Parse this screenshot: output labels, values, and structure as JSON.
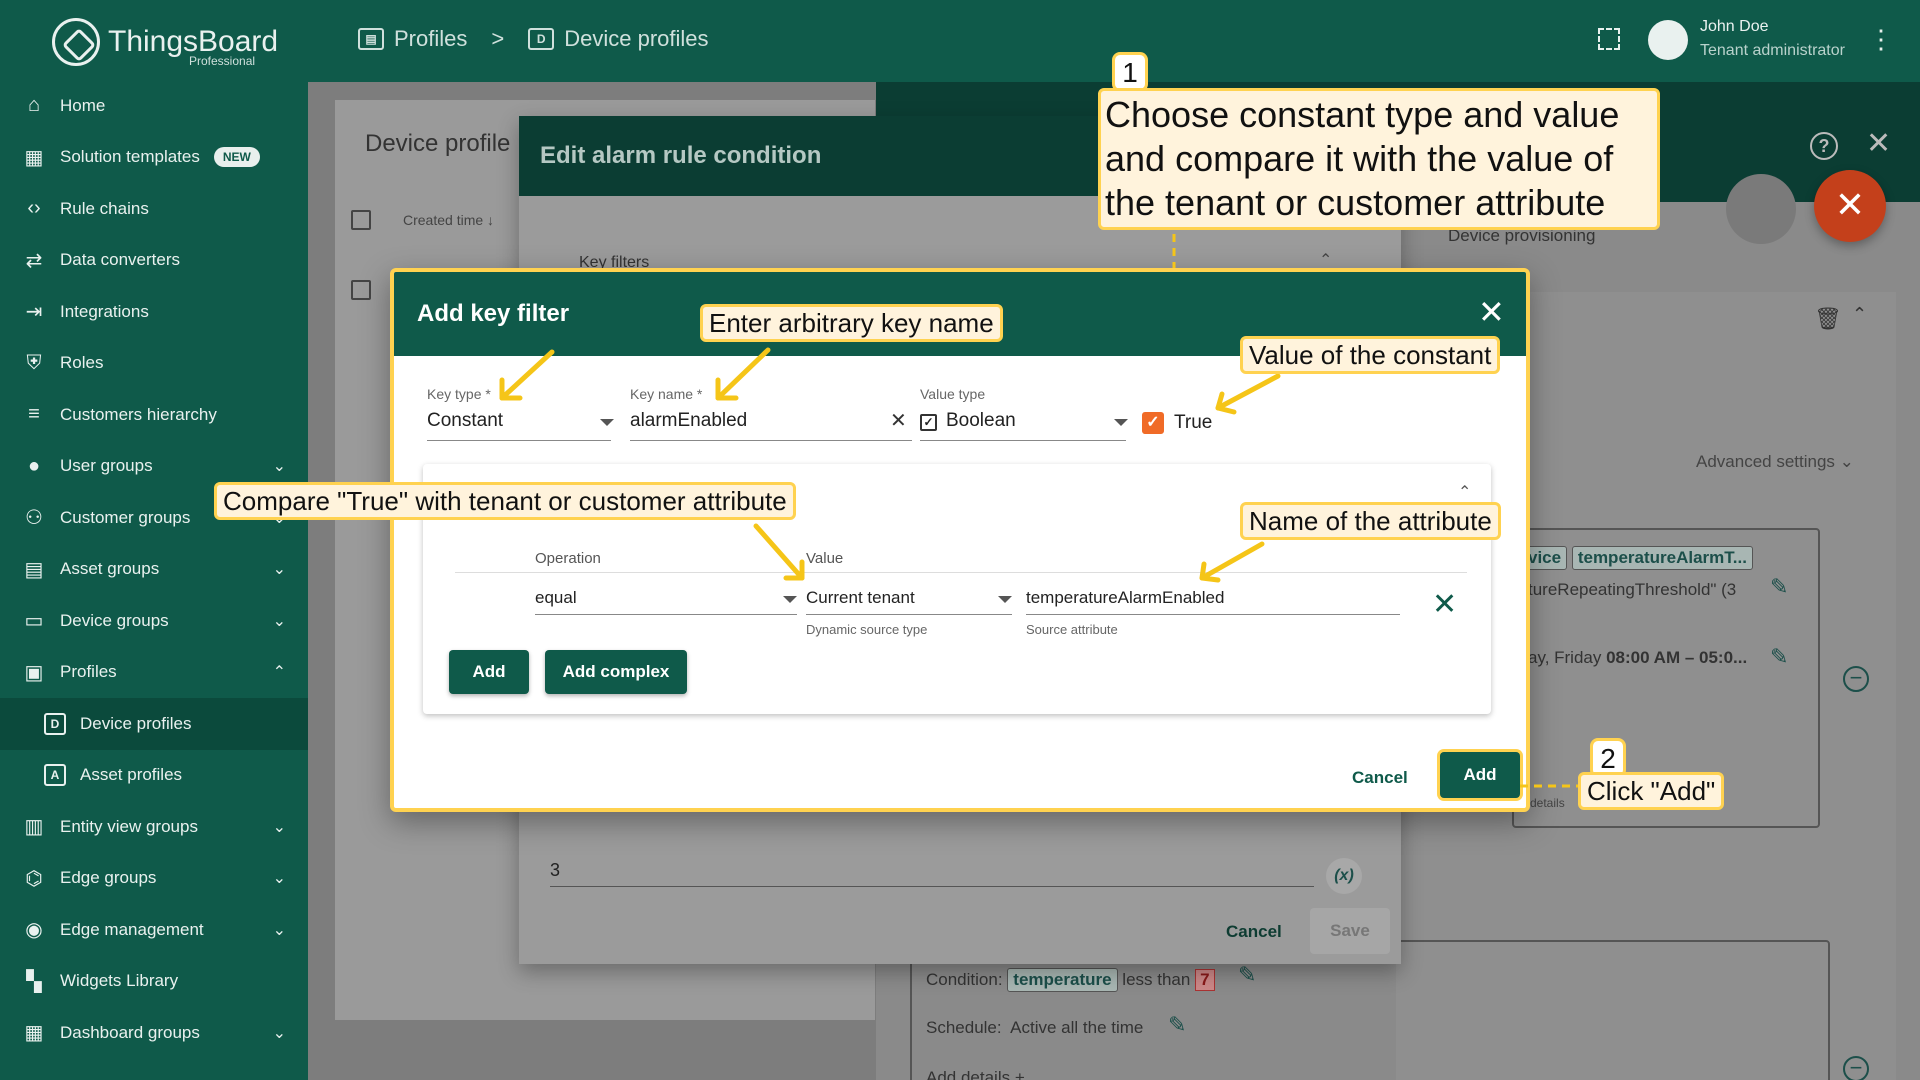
{
  "app": {
    "logo_name": "ThingsBoard",
    "logo_sub": "Professional"
  },
  "sidebar": {
    "items": [
      {
        "label": "Home",
        "icon": "home-icon"
      },
      {
        "label": "Solution templates",
        "icon": "grid-icon",
        "badge": "NEW"
      },
      {
        "label": "Rule chains",
        "icon": "code-icon"
      },
      {
        "label": "Data converters",
        "icon": "transform-icon"
      },
      {
        "label": "Integrations",
        "icon": "input-icon"
      },
      {
        "label": "Roles",
        "icon": "shield-icon"
      },
      {
        "label": "Customers hierarchy",
        "icon": "sort-icon"
      },
      {
        "label": "User groups",
        "icon": "account-icon",
        "expandable": true
      },
      {
        "label": "Customer groups",
        "icon": "group-icon",
        "expandable": true
      },
      {
        "label": "Asset groups",
        "icon": "building-icon",
        "expandable": true
      },
      {
        "label": "Device groups",
        "icon": "devices-icon",
        "expandable": true
      },
      {
        "label": "Profiles",
        "icon": "badge-icon",
        "expandable": true,
        "expanded": true
      },
      {
        "label": "Device profiles",
        "icon": "device-profile-icon",
        "sub": true,
        "active": true,
        "glyph": "D"
      },
      {
        "label": "Asset profiles",
        "icon": "asset-profile-icon",
        "sub": true,
        "glyph": "A"
      },
      {
        "label": "Entity view groups",
        "icon": "view-icon",
        "expandable": true
      },
      {
        "label": "Edge groups",
        "icon": "router-icon",
        "expandable": true
      },
      {
        "label": "Edge management",
        "icon": "wifi-icon",
        "expandable": true
      },
      {
        "label": "Widgets Library",
        "icon": "widgets-icon"
      },
      {
        "label": "Dashboard groups",
        "icon": "dashboard-icon",
        "expandable": true
      }
    ]
  },
  "topbar": {
    "breadcrumb": [
      {
        "label": "Profiles"
      },
      {
        "label": "Device profiles",
        "glyph": "D"
      }
    ],
    "breadcrumb_sep": ">",
    "user_name": "John Doe",
    "user_role": "Tenant administrator"
  },
  "background": {
    "profiles_title": "Device profile",
    "created_time_col": "Created time",
    "provisioning_tab": "Device provisioning",
    "advanced_settings": "Advanced settings",
    "alarm_chip_1": "vice",
    "alarm_chip_2": "temperatureAlarmT...",
    "alarm_line2": "tureRepeatingThreshold\" (3",
    "alarm_line3_prefix": "ay, Friday ",
    "alarm_line3_bold": "08:00 AM – 05:0...",
    "details_small": "details",
    "condition_label": "Condition:",
    "condition_key": "temperature",
    "condition_op": "less than",
    "condition_value": "7",
    "schedule_label": "Schedule:",
    "schedule_value": "Active all the time",
    "add_details": "Add details"
  },
  "edit_dialog": {
    "title": "Edit alarm rule condition",
    "key_filters_label": "Key filters",
    "bottom_value": "3",
    "fx_label": "(x)",
    "cancel": "Cancel",
    "save": "Save"
  },
  "add_key_filter": {
    "title": "Add key filter",
    "key_type_label": "Key type *",
    "key_type_value": "Constant",
    "key_name_label": "Key name *",
    "key_name_value": "alarmEnabled",
    "value_type_label": "Value type",
    "value_type_value": "Boolean",
    "constant_value_label": "True",
    "constant_checked": true,
    "operation_header": "Operation",
    "value_header": "Value",
    "operation_value": "equal",
    "dynamic_source_value": "Current tenant",
    "dynamic_source_hint": "Dynamic source type",
    "source_attribute_value": "temperatureAlarmEnabled",
    "source_attribute_hint": "Source attribute",
    "add_button": "Add",
    "add_complex_button": "Add complex",
    "cancel": "Cancel",
    "confirm_add": "Add"
  },
  "callouts": {
    "step1_number": "1",
    "step1_text": "Choose constant type and value and compare it with the value of the tenant or customer attribute",
    "key_name": "Enter arbitrary key name",
    "constant_value": "Value of the constant",
    "compare": "Compare \"True\" with tenant or customer attribute",
    "attribute_name": "Name of the attribute",
    "step2_number": "2",
    "step2_text": "Click \"Add\""
  },
  "colors": {
    "primary": "#0f5a4a",
    "accent_orange": "#f06b27",
    "callout_border": "#ffd250",
    "callout_bg": "#fff3dc",
    "fab_red": "#c4401b"
  }
}
